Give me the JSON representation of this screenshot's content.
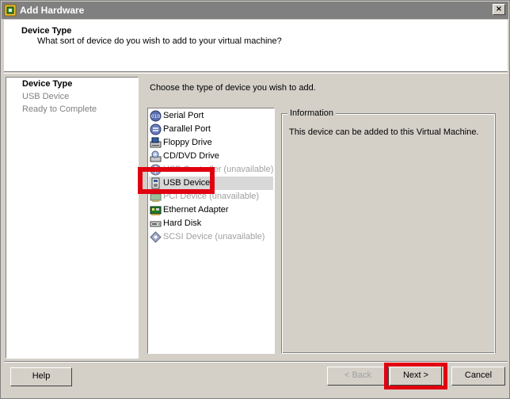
{
  "window": {
    "title": "Add Hardware",
    "close_glyph": "×",
    "icon": "vm-hardware-icon"
  },
  "header": {
    "title": "Device Type",
    "subtitle": "What sort of device do you wish to add to your virtual machine?"
  },
  "steps": [
    {
      "label": "Device Type",
      "state": "active"
    },
    {
      "label": "USB Device",
      "state": "inactive"
    },
    {
      "label": "Ready to Complete",
      "state": "inactive"
    }
  ],
  "main": {
    "instruction": "Choose the type of device you wish to add.",
    "devices": [
      {
        "label": "Serial Port",
        "icon": "serial-port-icon",
        "enabled": true
      },
      {
        "label": "Parallel Port",
        "icon": "parallel-port-icon",
        "enabled": true
      },
      {
        "label": "Floppy Drive",
        "icon": "floppy-drive-icon",
        "enabled": true
      },
      {
        "label": "CD/DVD Drive",
        "icon": "cd-dvd-drive-icon",
        "enabled": true
      },
      {
        "label": "USB Controller (unavailable)",
        "icon": "usb-controller-icon",
        "enabled": false
      },
      {
        "label": "USB Device",
        "icon": "usb-device-icon",
        "enabled": true,
        "selected": true
      },
      {
        "label": "PCI Device (unavailable)",
        "icon": "pci-device-icon",
        "enabled": false
      },
      {
        "label": "Ethernet Adapter",
        "icon": "ethernet-adapter-icon",
        "enabled": true
      },
      {
        "label": "Hard Disk",
        "icon": "hard-disk-icon",
        "enabled": true
      },
      {
        "label": "SCSI Device (unavailable)",
        "icon": "scsi-device-icon",
        "enabled": false
      }
    ]
  },
  "info": {
    "legend": "Information",
    "text": "This device can be added to this Virtual Machine."
  },
  "buttons": {
    "help": "Help",
    "back": "< Back",
    "next": "Next >",
    "cancel": "Cancel"
  },
  "colors": {
    "highlight": "#e00010",
    "dialog_bg": "#d4d0c8",
    "titlebar": "#808080"
  }
}
